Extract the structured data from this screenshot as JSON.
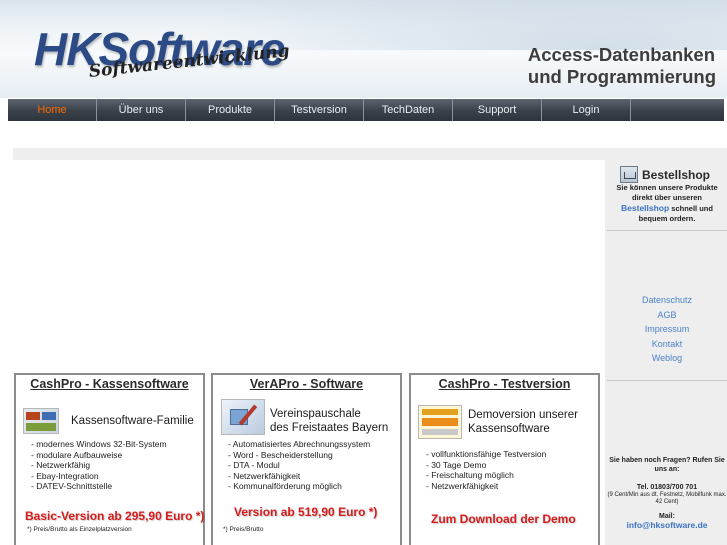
{
  "header": {
    "logo_main": "HKSoftware",
    "logo_sub": "Softwareentwicklung",
    "tagline_line1": "Access-Datenbanken",
    "tagline_line2": "und Programmierung"
  },
  "nav": {
    "items": [
      "Home",
      "Über uns",
      "Produkte",
      "Testversion",
      "TechDaten",
      "Support",
      "Login",
      ""
    ],
    "active": "Home"
  },
  "sidebar": {
    "shop_title": "Bestellshop",
    "shop_text_1": "Sie können unsere Produkte direkt über unseren",
    "shop_link": "Bestellshop",
    "shop_text_2": "schnell und bequem ordern.",
    "links": [
      "Datenschutz",
      "AGB",
      "Impressum",
      "Kontakt",
      "Weblog"
    ],
    "contact_question": "Sie haben noch Fragen? Rufen Sie uns an:",
    "phone": "Tel. 01803/700 701",
    "phone_note": "(9 Cent/Min aus dt. Festnetz, Mobilfunk max. 42 Cent)",
    "mail_label": "Mail:",
    "mail": "info@hksoftware.de"
  },
  "boxes": [
    {
      "title": "CashPro - Kassensoftware",
      "headline": "Kassensoftware-Familie",
      "features": [
        "- modernes Windows 32-Bit-System",
        "- modulare Aufbauweise",
        "- Netzwerkfähig",
        "- Ebay-Integration",
        "- DATEV-Schnittstelle"
      ],
      "price": "Basic-Version ab 295,90 Euro *)",
      "note": "*) Preis/Brutto als Einzelplatzversion"
    },
    {
      "title": "VerAPro - Software",
      "headline_1": "Vereinspauschale",
      "headline_2": "des Freistaates Bayern",
      "features": [
        "- Automatisiertes Abrechnungssystem",
        "- Word - Bescheiderstellung",
        "- DTA - Modul",
        "- Netzwerkfähigkeit",
        "- Kommunalförderung möglich"
      ],
      "price": "Version ab 519,90 Euro *)",
      "note": "*) Preis/Brutto"
    },
    {
      "title": "CashPro - Testversion",
      "headline_1": "Demoversion unserer",
      "headline_2": "Kassensoftware",
      "features": [
        "- vollfunktionsfähige Testversion",
        "- 30 Tage Demo",
        "- Freischaltung möglich",
        "- Netzwerkfähigkeit"
      ],
      "price": "Zum Download der Demo"
    }
  ],
  "colors": {
    "nav_active": "#ff6a00",
    "price_red": "#d71a1a",
    "link_blue": "#4d82c9",
    "logo_blue": "#2b4a86"
  }
}
